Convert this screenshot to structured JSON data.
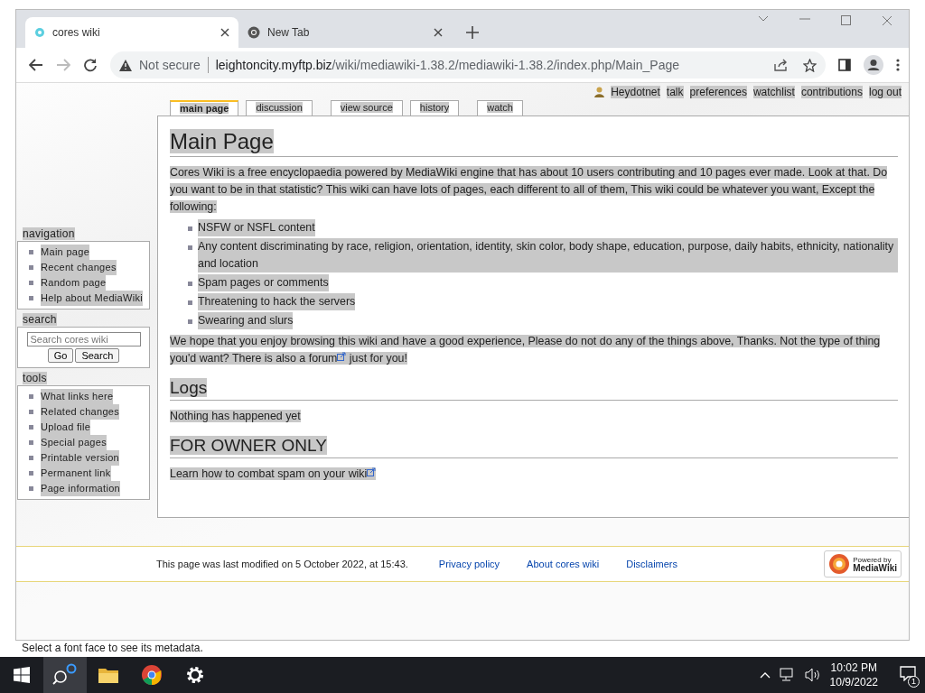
{
  "browser": {
    "tabs": [
      {
        "title": "cores wiki",
        "selected": true
      },
      {
        "title": "New Tab",
        "selected": false
      }
    ],
    "security": "Not secure",
    "url_host": "leightoncity.myftp.biz",
    "url_path": "/wiki/mediawiki-1.38.2/mediawiki-1.38.2/index.php/Main_Page"
  },
  "user_links": [
    "Heydotnet",
    "talk",
    "preferences",
    "watchlist",
    "contributions",
    "log out"
  ],
  "page_tabs": [
    {
      "label": "main page",
      "selected": true
    },
    {
      "label": "discussion",
      "selected": false
    },
    {
      "label": "view source",
      "selected": false
    },
    {
      "label": "history",
      "selected": false
    },
    {
      "label": "watch",
      "selected": false
    }
  ],
  "sidebar": {
    "navigation": {
      "title": "navigation",
      "items": [
        "Main page",
        "Recent changes",
        "Random page",
        "Help about MediaWiki"
      ]
    },
    "search": {
      "title": "search",
      "placeholder": "Search cores wiki",
      "buttons": [
        "Go",
        "Search"
      ]
    },
    "tools": {
      "title": "tools",
      "items": [
        "What links here",
        "Related changes",
        "Upload file",
        "Special pages",
        "Printable version",
        "Permanent link",
        "Page information"
      ]
    }
  },
  "article": {
    "title": "Main Page",
    "intro": "Cores Wiki is a free encyclopaedia powered by MediaWiki engine that has about 10 users contributing and 10 pages ever made. Look at that. Do you want to be in that statistic? This wiki can have lots of pages, each different to all of them, This wiki could be whatever you want, Except the following:",
    "list": [
      "NSFW or NSFL content",
      "Any content discriminating by race, religion, orientation, identity, skin color, body shape, education, purpose, daily habits, ethnicity, nationality and location",
      "Spam pages or comments",
      "Threatening to hack the servers",
      "Swearing and slurs"
    ],
    "outro_before": "We hope that you enjoy browsing this wiki and have a good experience, Please do not do any of the things above, Thanks. Not the type of thing you'd want? There is also a",
    "outro_link": "forum",
    "outro_after": "just for you!",
    "sections": [
      {
        "heading": "Logs",
        "text": "Nothing has happened yet",
        "kind": "text"
      },
      {
        "heading": "FOR OWNER ONLY",
        "text": "Learn how to combat spam on your wiki",
        "kind": "link"
      }
    ]
  },
  "footer": {
    "modified": "This page was last modified on 5 October 2022, at 15:43.",
    "links": [
      "Privacy policy",
      "About cores wiki",
      "Disclaimers"
    ],
    "badge_top": "Powered by",
    "badge_bottom": "MediaWiki"
  },
  "background_text": "Select a font face to see its metadata.",
  "taskbar": {
    "time": "10:02 PM",
    "date": "10/9/2022",
    "notifications": "1"
  }
}
